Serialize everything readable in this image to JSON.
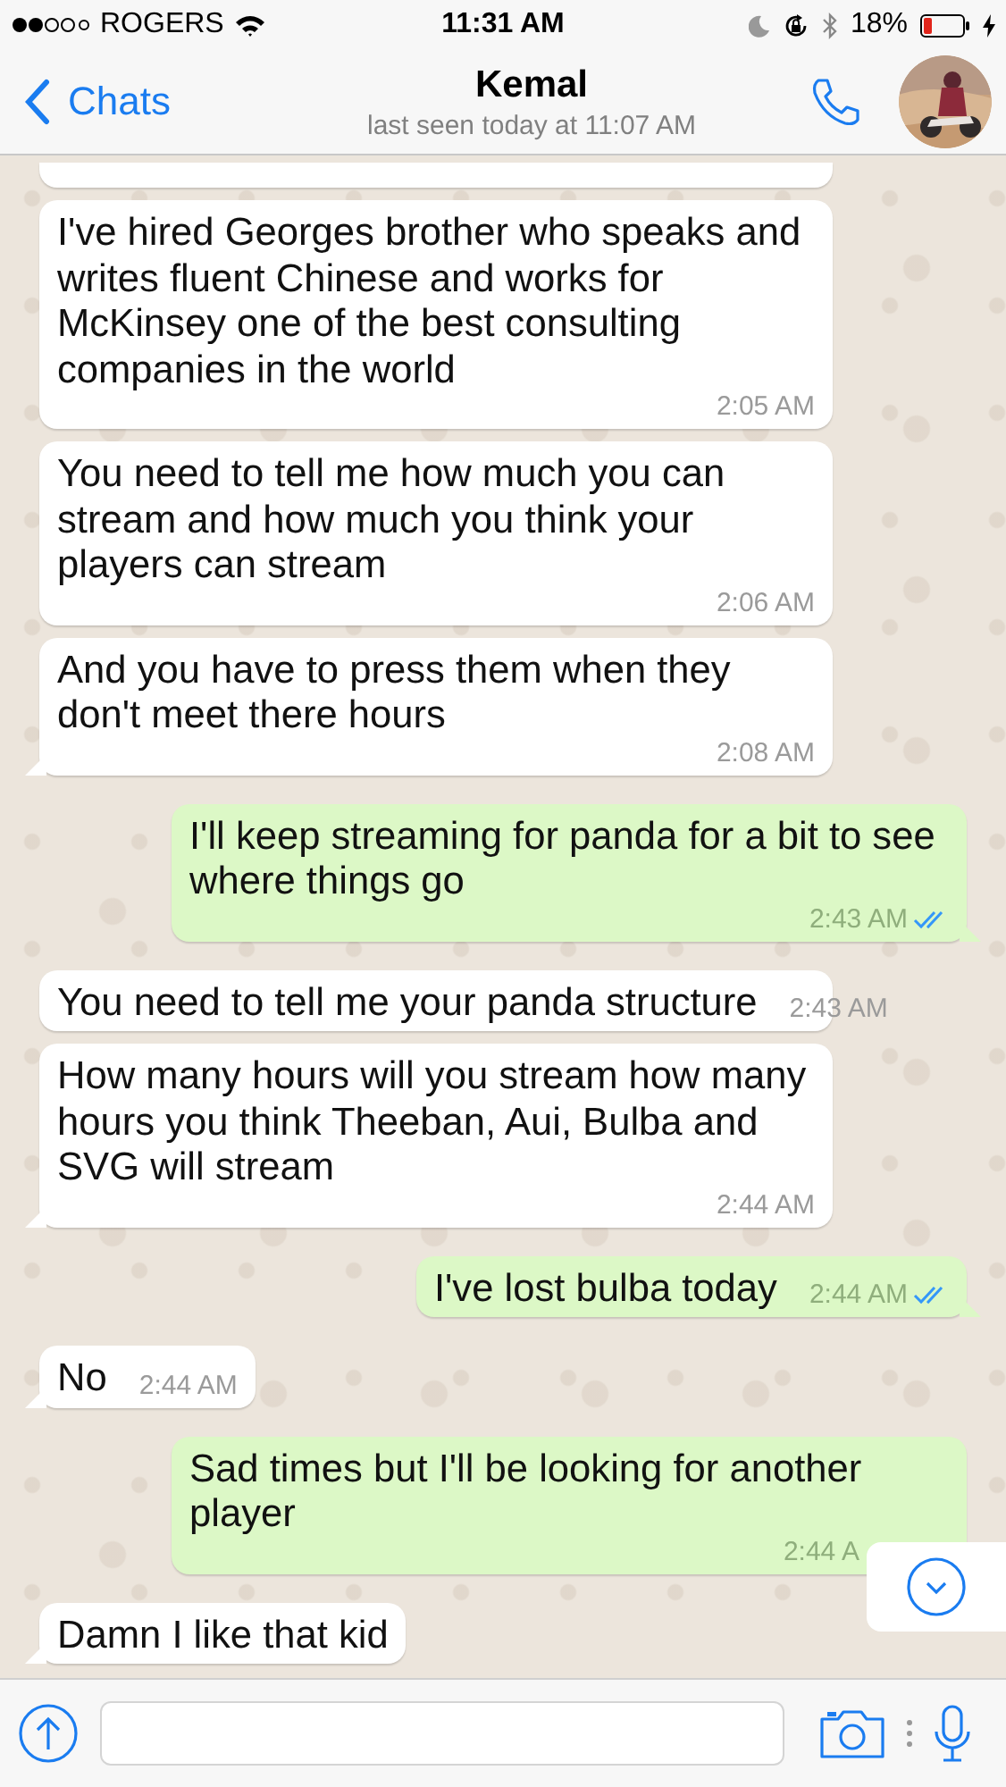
{
  "status_bar": {
    "carrier": "ROGERS",
    "time": "11:31 AM",
    "battery": "18%"
  },
  "header": {
    "back": "Chats",
    "title": "Kemal",
    "subtitle": "last seen today at 11:07 AM"
  },
  "messages": [
    {
      "kind": "incoming",
      "text": "I've hired Georges brother who speaks and writes fluent Chinese and works for McKinsey one of the best consulting companies in the world",
      "time": "2:05 AM"
    },
    {
      "kind": "incoming",
      "text": "You need to tell me how much you can stream and how much you think your players can stream",
      "time": "2:06 AM"
    },
    {
      "kind": "incoming",
      "text": "And you have to press them when they don't meet there hours",
      "time": "2:08 AM"
    },
    {
      "kind": "outgoing",
      "text": "I'll keep streaming for panda for a bit to see where things go",
      "time": "2:43 AM",
      "read": true
    },
    {
      "kind": "incoming",
      "text": "You need to tell me your panda structure",
      "time": "2:43 AM"
    },
    {
      "kind": "incoming",
      "text": "How many hours will you stream how many hours you think Theeban, Aui, Bulba and SVG will stream",
      "time": "2:44 AM"
    },
    {
      "kind": "outgoing",
      "text": "I've lost bulba today",
      "time": "2:44 AM",
      "read": true
    },
    {
      "kind": "incoming",
      "text": "No",
      "time": "2:44 AM"
    },
    {
      "kind": "outgoing",
      "text": "Sad times but I'll be looking for another player",
      "time": "2:44 A"
    },
    {
      "kind": "incoming",
      "text": "Damn I like that kid"
    }
  ]
}
